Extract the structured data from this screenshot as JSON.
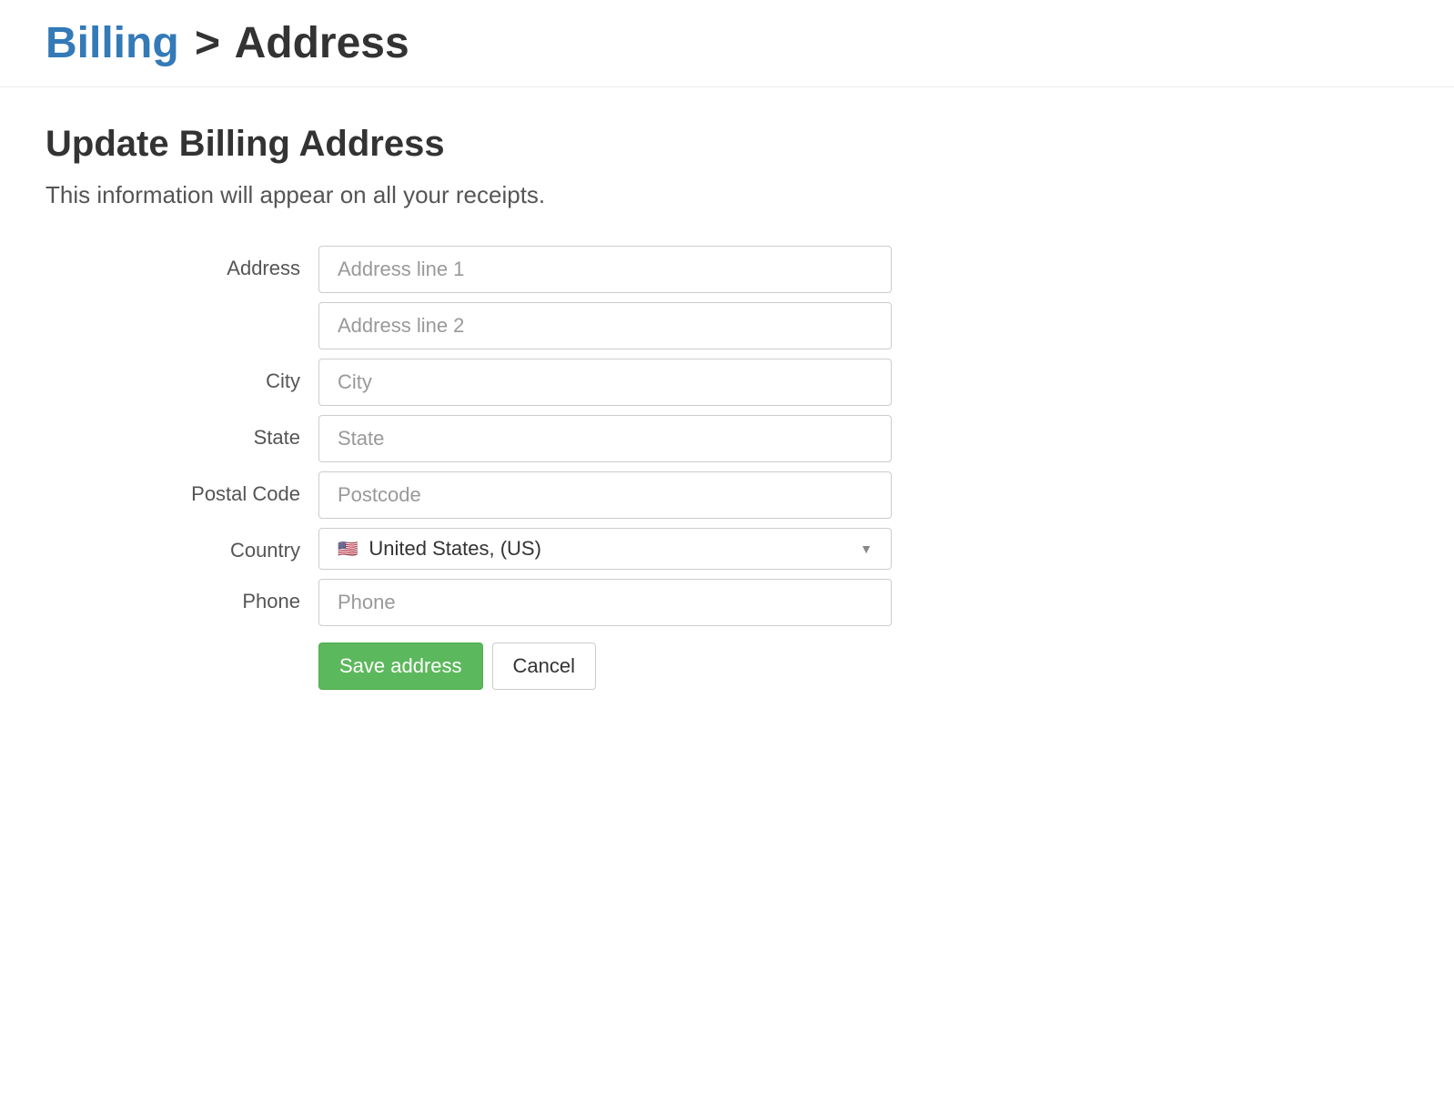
{
  "breadcrumb": {
    "parent": "Billing",
    "separator": ">",
    "current": "Address"
  },
  "header": {
    "title": "Update Billing Address",
    "subtitle": "This information will appear on all your receipts."
  },
  "form": {
    "address": {
      "label": "Address",
      "line1_placeholder": "Address line 1",
      "line1_value": "",
      "line2_placeholder": "Address line 2",
      "line2_value": ""
    },
    "city": {
      "label": "City",
      "placeholder": "City",
      "value": ""
    },
    "state": {
      "label": "State",
      "placeholder": "State",
      "value": ""
    },
    "postal_code": {
      "label": "Postal Code",
      "placeholder": "Postcode",
      "value": ""
    },
    "country": {
      "label": "Country",
      "flag": "🇺🇸",
      "selected": "United States, (US)"
    },
    "phone": {
      "label": "Phone",
      "placeholder": "Phone",
      "value": ""
    }
  },
  "buttons": {
    "save": "Save address",
    "cancel": "Cancel"
  },
  "colors": {
    "link": "#337ab7",
    "primary_button_bg": "#5cb85c",
    "border": "#cccccc"
  }
}
